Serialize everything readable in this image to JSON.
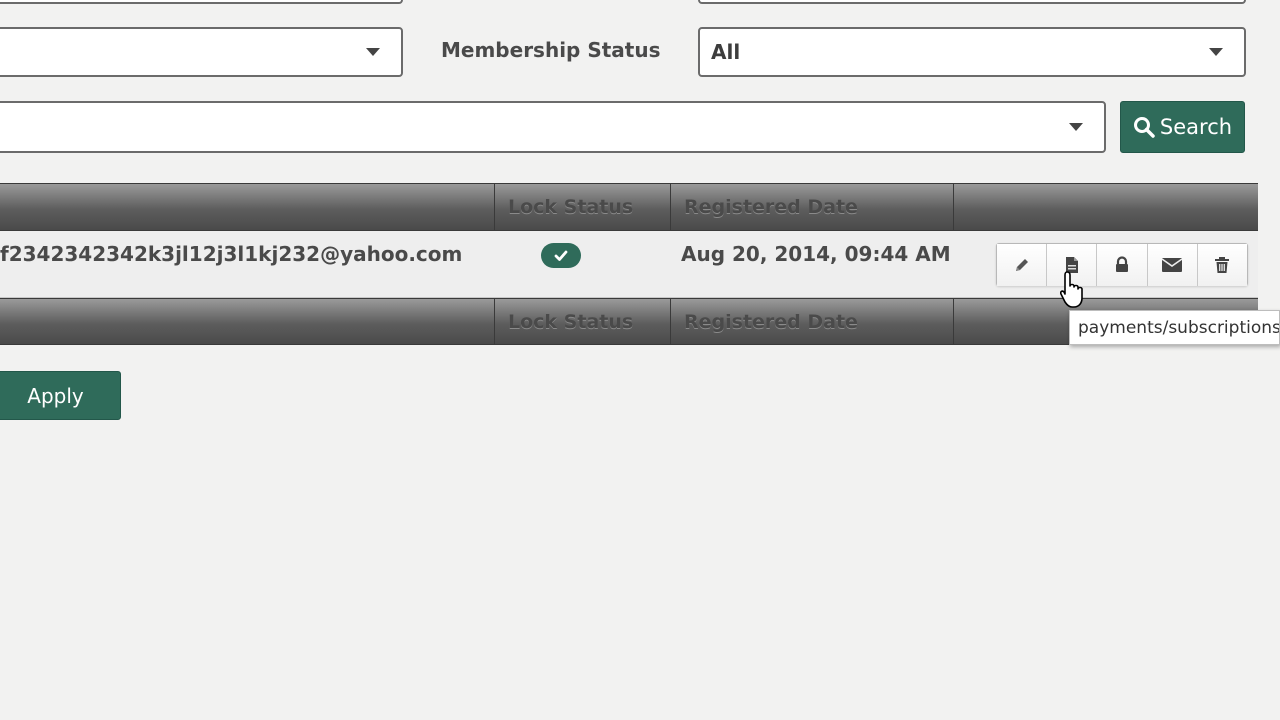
{
  "filters": {
    "left_select_value": "",
    "membership_status_label": "Membership Status",
    "membership_status_value": "All",
    "wide_select_value": "",
    "search_button_label": "Search"
  },
  "table": {
    "headers": {
      "col1": "",
      "lock_status": "Lock Status",
      "registered_date": "Registered Date",
      "actions": ""
    },
    "rows": [
      {
        "email": "f2342342342k3jl12j3l1kj232@yahoo.com",
        "lock_status": "unlocked",
        "registered_date": "Aug 20, 2014, 09:44 AM"
      }
    ],
    "action_icons": [
      "pencil-icon",
      "document-icon",
      "lock-icon",
      "envelope-icon",
      "trash-icon"
    ]
  },
  "tooltip": {
    "text": "payments/subscriptions"
  },
  "apply_button_label": "Apply",
  "colors": {
    "accent": "#2f6b5a",
    "header_dark": "#4a4a4a",
    "background": "#f2f2f1"
  }
}
